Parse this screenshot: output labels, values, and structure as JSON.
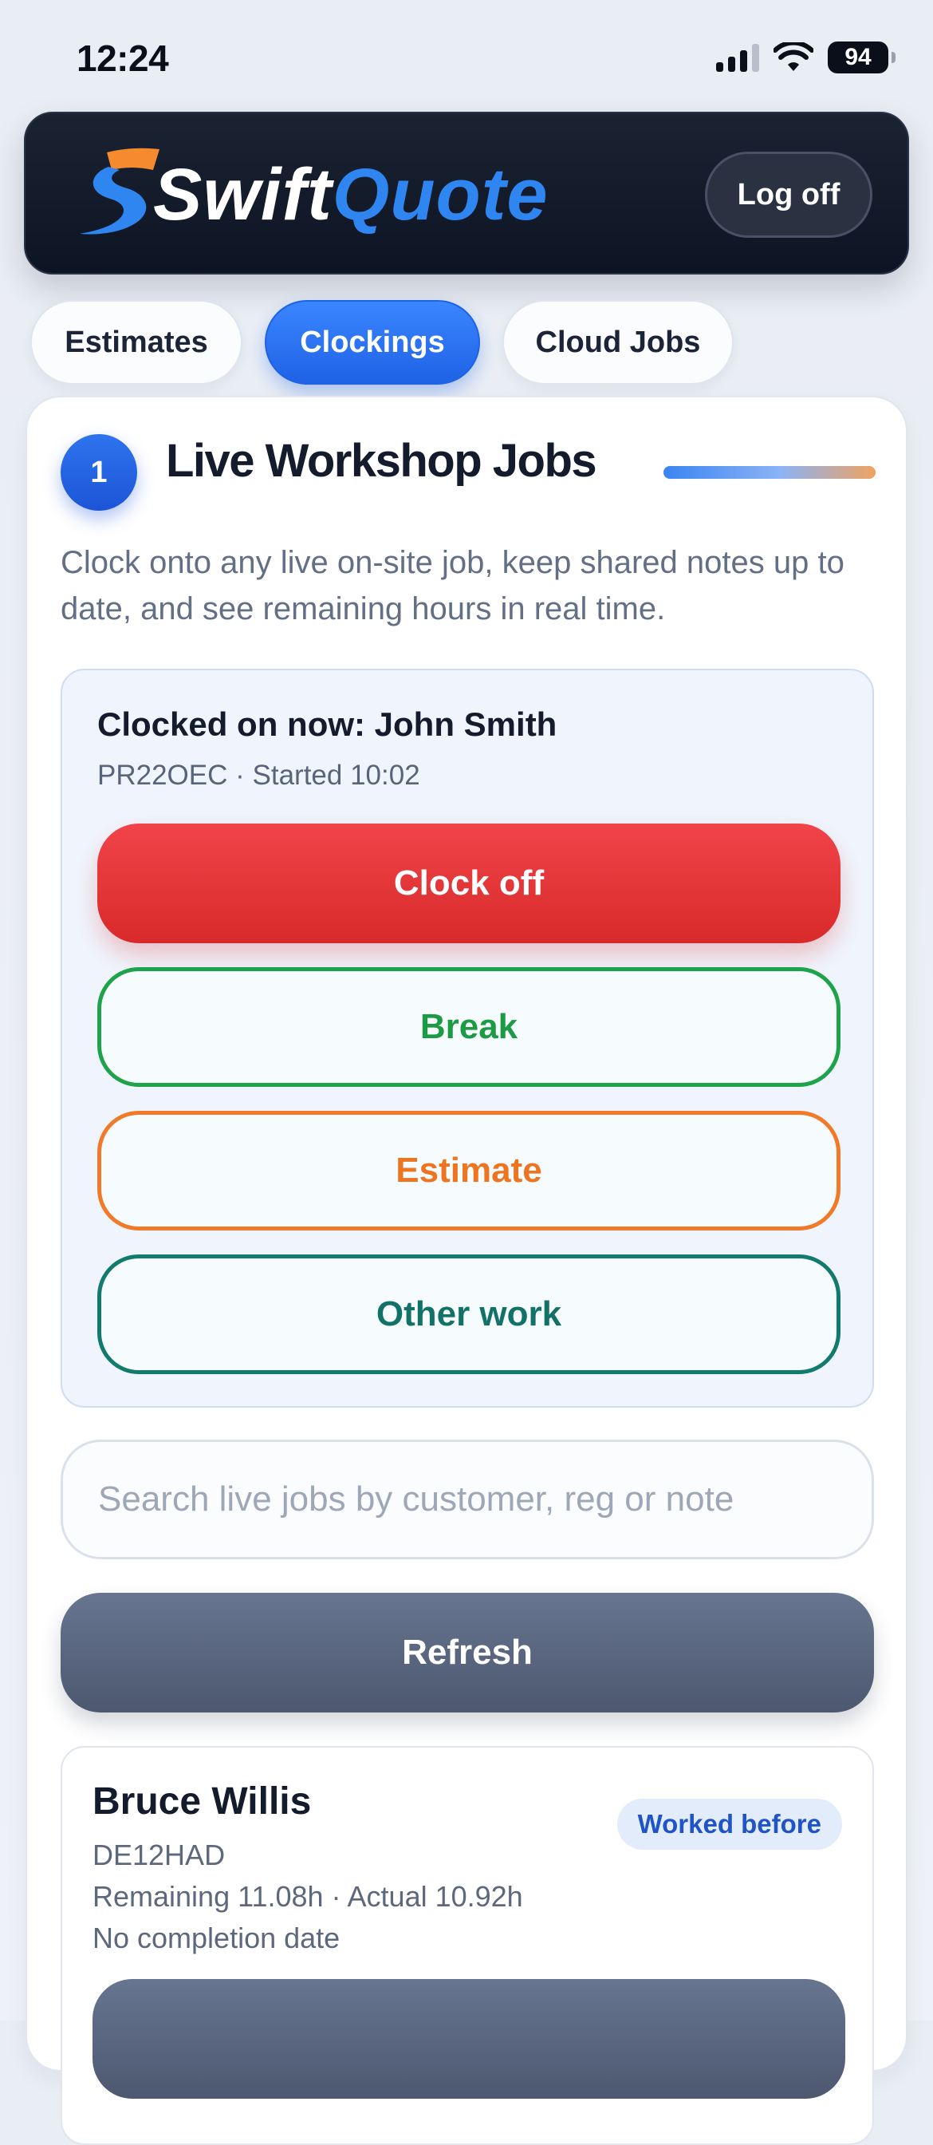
{
  "status_bar": {
    "time": "12:24",
    "battery": "94"
  },
  "header": {
    "logo_part1": "Swift",
    "logo_part2": "Quote",
    "logoff_label": "Log off"
  },
  "tabs": [
    {
      "label": "Estimates",
      "active": false
    },
    {
      "label": "Clockings",
      "active": true
    },
    {
      "label": "Cloud Jobs",
      "active": false
    }
  ],
  "panel": {
    "step": "1",
    "title": "Live Workshop Jobs",
    "description": "Clock onto any live on-site job, keep shared notes up to date, and see remaining hours in real time."
  },
  "clocked": {
    "title": "Clocked on now: John Smith",
    "subtitle": "PR22OEC · Started 10:02",
    "clock_off_label": "Clock off",
    "break_label": "Break",
    "estimate_label": "Estimate",
    "other_work_label": "Other work"
  },
  "search": {
    "placeholder": "Search live jobs by customer, reg or note",
    "value": ""
  },
  "refresh_label": "Refresh",
  "jobs": [
    {
      "customer": "Bruce Willis",
      "badge": "Worked before",
      "reg": "DE12HAD",
      "hours": "Remaining 11.08h · Actual 10.92h",
      "completion": "No completion date"
    }
  ]
}
